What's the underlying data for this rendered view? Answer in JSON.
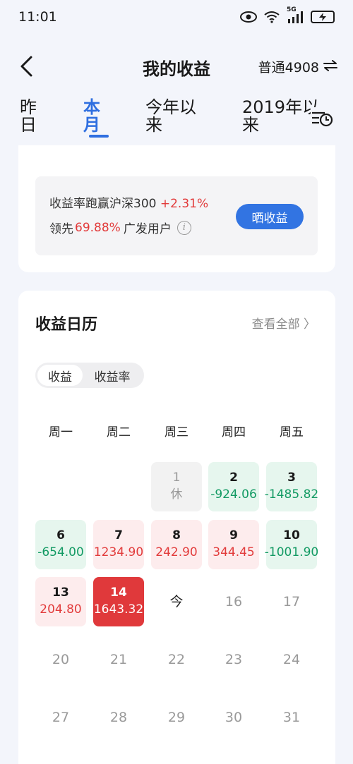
{
  "status_bar": {
    "time": "11:01",
    "signal_label": "5G"
  },
  "header": {
    "title": "我的收益",
    "account": "普通4908"
  },
  "tabs": [
    {
      "label_line1": "昨",
      "label_line2": "日"
    },
    {
      "label_line1": "本",
      "label_line2": "月"
    },
    {
      "label_line1": "今年以",
      "label_line2": "来"
    },
    {
      "label_line1": "2019年以",
      "label_line2": "来"
    }
  ],
  "summary": {
    "compare_text": "收益率跑赢沪深300",
    "compare_value": "+2.31%",
    "lead_prefix": "领先",
    "lead_value": "69.88%",
    "lead_suffix": "广发用户",
    "info_glyph": "i",
    "share_label": "晒收益"
  },
  "calendar": {
    "title": "收益日历",
    "view_all": "查看全部 〉",
    "toggle": [
      "收益",
      "收益率"
    ],
    "weekdays": [
      "周一",
      "周二",
      "周三",
      "周四",
      "周五"
    ],
    "days": [
      {
        "day": "1",
        "value": "休",
        "state": "holiday"
      },
      {
        "day": "2",
        "value": "-924.06",
        "state": "down"
      },
      {
        "day": "3",
        "value": "-1485.82",
        "state": "down"
      },
      {
        "day": "6",
        "value": "-654.00",
        "state": "down"
      },
      {
        "day": "7",
        "value": "1234.90",
        "state": "up"
      },
      {
        "day": "8",
        "value": "242.90",
        "state": "up"
      },
      {
        "day": "9",
        "value": "344.45",
        "state": "up"
      },
      {
        "day": "10",
        "value": "-1001.90",
        "state": "down"
      },
      {
        "day": "13",
        "value": "204.80",
        "state": "up"
      },
      {
        "day": "14",
        "value": "1643.32",
        "state": "selected"
      },
      {
        "day": "今",
        "value": "",
        "state": "today"
      },
      {
        "day": "16",
        "value": "",
        "state": "future"
      },
      {
        "day": "17",
        "value": "",
        "state": "future"
      },
      {
        "day": "20",
        "value": "",
        "state": "future"
      },
      {
        "day": "21",
        "value": "",
        "state": "future"
      },
      {
        "day": "22",
        "value": "",
        "state": "future"
      },
      {
        "day": "23",
        "value": "",
        "state": "future"
      },
      {
        "day": "24",
        "value": "",
        "state": "future"
      },
      {
        "day": "27",
        "value": "",
        "state": "future"
      },
      {
        "day": "28",
        "value": "",
        "state": "future"
      },
      {
        "day": "29",
        "value": "",
        "state": "future"
      },
      {
        "day": "30",
        "value": "",
        "state": "future"
      },
      {
        "day": "31",
        "value": "",
        "state": "future"
      }
    ]
  },
  "colors": {
    "accent": "#2f6fe0",
    "gain": "#e23b3b",
    "loss": "#129a63",
    "selected": "#e0393b"
  }
}
